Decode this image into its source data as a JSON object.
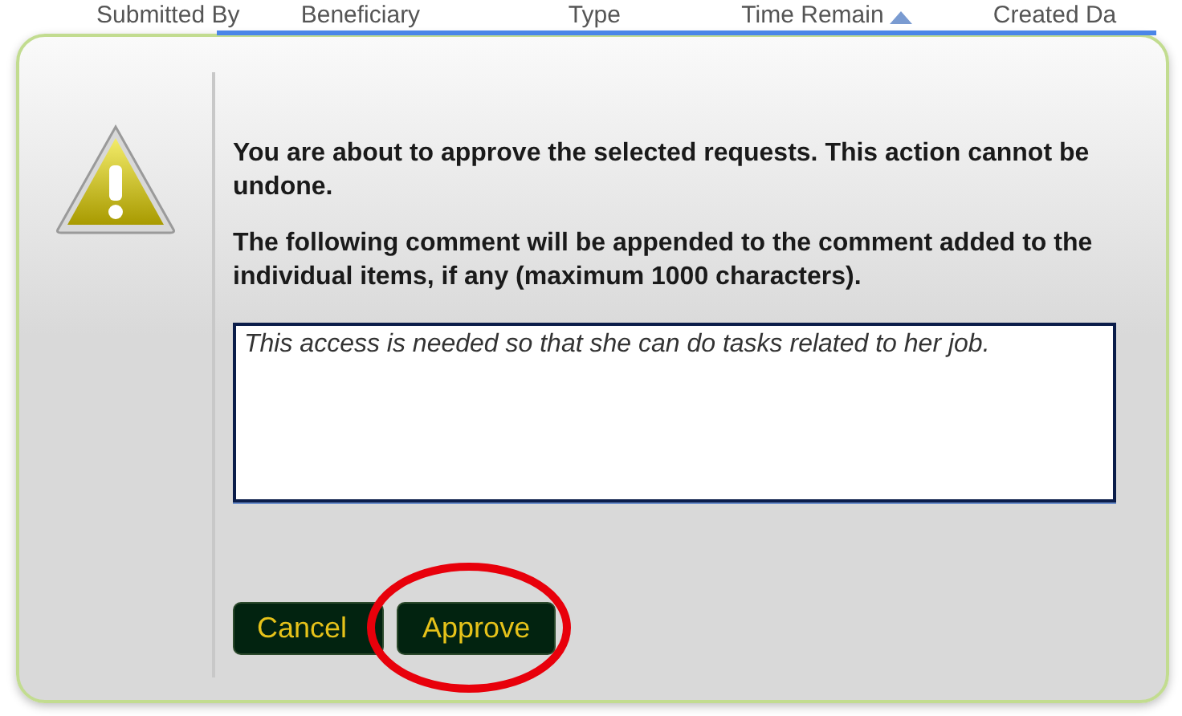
{
  "table_header": {
    "columns": [
      {
        "label": "Submitted By",
        "sorted": false
      },
      {
        "label": "Beneficiary",
        "sorted": false
      },
      {
        "label": "Type",
        "sorted": false
      },
      {
        "label": "Time Remain",
        "sorted": true
      },
      {
        "label": "Created Da",
        "sorted": false
      }
    ]
  },
  "dialog": {
    "message": "You are about to approve the selected requests. This action cannot be undone.",
    "comment_prompt": "The following comment will be appended to the comment added to the individual items, if any (maximum 1000 characters).",
    "comment": {
      "value": "This access is needed so that she can do tasks related to her job."
    },
    "buttons": [
      {
        "label": "Cancel",
        "highlighted": false
      },
      {
        "label": "Approve",
        "highlighted": true
      }
    ]
  }
}
